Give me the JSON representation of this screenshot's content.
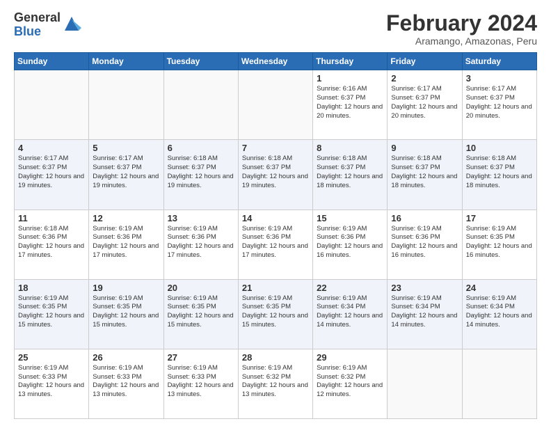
{
  "logo": {
    "general": "General",
    "blue": "Blue"
  },
  "header": {
    "title": "February 2024",
    "subtitle": "Aramango, Amazonas, Peru"
  },
  "days_of_week": [
    "Sunday",
    "Monday",
    "Tuesday",
    "Wednesday",
    "Thursday",
    "Friday",
    "Saturday"
  ],
  "weeks": [
    [
      {
        "day": "",
        "info": ""
      },
      {
        "day": "",
        "info": ""
      },
      {
        "day": "",
        "info": ""
      },
      {
        "day": "",
        "info": ""
      },
      {
        "day": "1",
        "info": "Sunrise: 6:16 AM\nSunset: 6:37 PM\nDaylight: 12 hours and 20 minutes."
      },
      {
        "day": "2",
        "info": "Sunrise: 6:17 AM\nSunset: 6:37 PM\nDaylight: 12 hours and 20 minutes."
      },
      {
        "day": "3",
        "info": "Sunrise: 6:17 AM\nSunset: 6:37 PM\nDaylight: 12 hours and 20 minutes."
      }
    ],
    [
      {
        "day": "4",
        "info": "Sunrise: 6:17 AM\nSunset: 6:37 PM\nDaylight: 12 hours and 19 minutes."
      },
      {
        "day": "5",
        "info": "Sunrise: 6:17 AM\nSunset: 6:37 PM\nDaylight: 12 hours and 19 minutes."
      },
      {
        "day": "6",
        "info": "Sunrise: 6:18 AM\nSunset: 6:37 PM\nDaylight: 12 hours and 19 minutes."
      },
      {
        "day": "7",
        "info": "Sunrise: 6:18 AM\nSunset: 6:37 PM\nDaylight: 12 hours and 19 minutes."
      },
      {
        "day": "8",
        "info": "Sunrise: 6:18 AM\nSunset: 6:37 PM\nDaylight: 12 hours and 18 minutes."
      },
      {
        "day": "9",
        "info": "Sunrise: 6:18 AM\nSunset: 6:37 PM\nDaylight: 12 hours and 18 minutes."
      },
      {
        "day": "10",
        "info": "Sunrise: 6:18 AM\nSunset: 6:37 PM\nDaylight: 12 hours and 18 minutes."
      }
    ],
    [
      {
        "day": "11",
        "info": "Sunrise: 6:18 AM\nSunset: 6:36 PM\nDaylight: 12 hours and 17 minutes."
      },
      {
        "day": "12",
        "info": "Sunrise: 6:19 AM\nSunset: 6:36 PM\nDaylight: 12 hours and 17 minutes."
      },
      {
        "day": "13",
        "info": "Sunrise: 6:19 AM\nSunset: 6:36 PM\nDaylight: 12 hours and 17 minutes."
      },
      {
        "day": "14",
        "info": "Sunrise: 6:19 AM\nSunset: 6:36 PM\nDaylight: 12 hours and 17 minutes."
      },
      {
        "day": "15",
        "info": "Sunrise: 6:19 AM\nSunset: 6:36 PM\nDaylight: 12 hours and 16 minutes."
      },
      {
        "day": "16",
        "info": "Sunrise: 6:19 AM\nSunset: 6:36 PM\nDaylight: 12 hours and 16 minutes."
      },
      {
        "day": "17",
        "info": "Sunrise: 6:19 AM\nSunset: 6:35 PM\nDaylight: 12 hours and 16 minutes."
      }
    ],
    [
      {
        "day": "18",
        "info": "Sunrise: 6:19 AM\nSunset: 6:35 PM\nDaylight: 12 hours and 15 minutes."
      },
      {
        "day": "19",
        "info": "Sunrise: 6:19 AM\nSunset: 6:35 PM\nDaylight: 12 hours and 15 minutes."
      },
      {
        "day": "20",
        "info": "Sunrise: 6:19 AM\nSunset: 6:35 PM\nDaylight: 12 hours and 15 minutes."
      },
      {
        "day": "21",
        "info": "Sunrise: 6:19 AM\nSunset: 6:35 PM\nDaylight: 12 hours and 15 minutes."
      },
      {
        "day": "22",
        "info": "Sunrise: 6:19 AM\nSunset: 6:34 PM\nDaylight: 12 hours and 14 minutes."
      },
      {
        "day": "23",
        "info": "Sunrise: 6:19 AM\nSunset: 6:34 PM\nDaylight: 12 hours and 14 minutes."
      },
      {
        "day": "24",
        "info": "Sunrise: 6:19 AM\nSunset: 6:34 PM\nDaylight: 12 hours and 14 minutes."
      }
    ],
    [
      {
        "day": "25",
        "info": "Sunrise: 6:19 AM\nSunset: 6:33 PM\nDaylight: 12 hours and 13 minutes."
      },
      {
        "day": "26",
        "info": "Sunrise: 6:19 AM\nSunset: 6:33 PM\nDaylight: 12 hours and 13 minutes."
      },
      {
        "day": "27",
        "info": "Sunrise: 6:19 AM\nSunset: 6:33 PM\nDaylight: 12 hours and 13 minutes."
      },
      {
        "day": "28",
        "info": "Sunrise: 6:19 AM\nSunset: 6:32 PM\nDaylight: 12 hours and 13 minutes."
      },
      {
        "day": "29",
        "info": "Sunrise: 6:19 AM\nSunset: 6:32 PM\nDaylight: 12 hours and 12 minutes."
      },
      {
        "day": "",
        "info": ""
      },
      {
        "day": "",
        "info": ""
      }
    ]
  ]
}
